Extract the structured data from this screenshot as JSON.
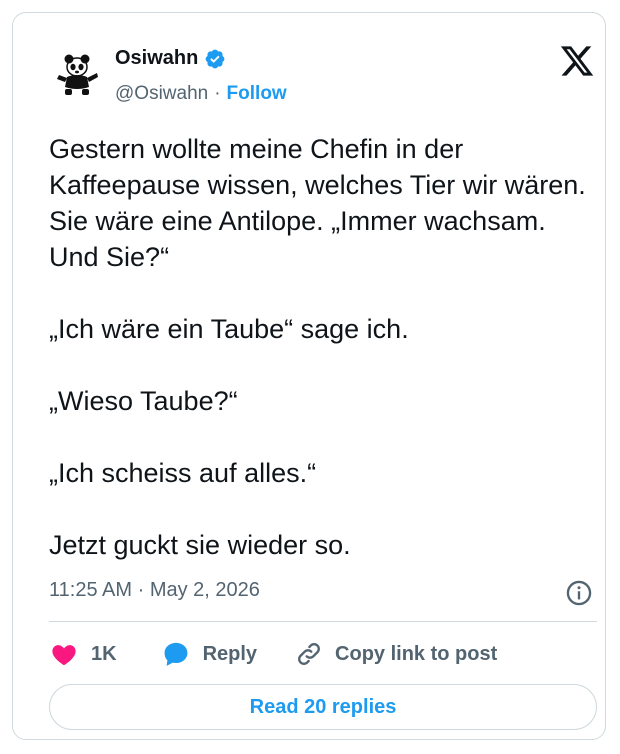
{
  "author": {
    "name": "Osiwahn",
    "handle": "@Osiwahn",
    "separator": "·",
    "follow_label": "Follow",
    "verified_badge_color": "#1d9bf0",
    "avatar_icon": "panda-icon"
  },
  "brand_icon": "x-logo-icon",
  "tweet": {
    "paragraphs": [
      "Gestern wollte meine Chefin in der Kaffeepause wissen, welches Tier wir wären. Sie wäre eine Antilope. „Immer wachsam. Und Sie?“",
      "„Ich wäre ein Taube“ sage ich.",
      "„Wieso Taube?“",
      "„Ich scheiss auf alles.“",
      "Jetzt guckt sie wieder so."
    ]
  },
  "meta": {
    "time": "11:25 AM",
    "separator": "·",
    "date": "May 2, 2026"
  },
  "actions": {
    "like_count": "1K",
    "reply_label": "Reply",
    "copy_label": "Copy link to post"
  },
  "read_replies_label": "Read 20 replies",
  "colors": {
    "accent": "#1d9bf0",
    "like": "#f91880",
    "muted_text": "#536471",
    "border": "#cfd9de"
  }
}
